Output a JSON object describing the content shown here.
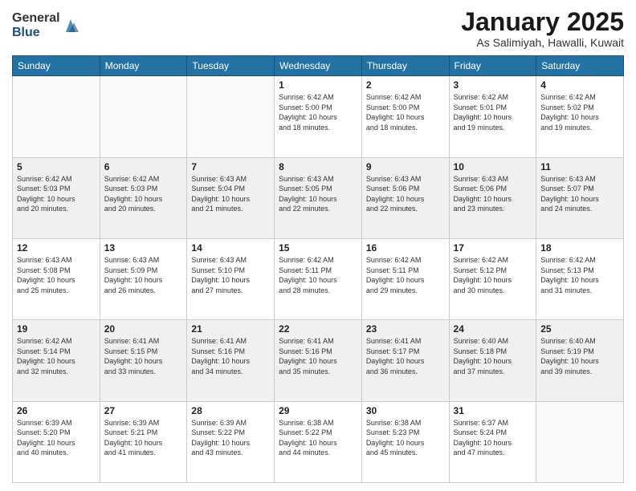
{
  "logo": {
    "general": "General",
    "blue": "Blue"
  },
  "title": "January 2025",
  "location": "As Salimiyah, Hawalli, Kuwait",
  "weekdays": [
    "Sunday",
    "Monday",
    "Tuesday",
    "Wednesday",
    "Thursday",
    "Friday",
    "Saturday"
  ],
  "weeks": [
    [
      {
        "day": "",
        "info": ""
      },
      {
        "day": "",
        "info": ""
      },
      {
        "day": "",
        "info": ""
      },
      {
        "day": "1",
        "info": "Sunrise: 6:42 AM\nSunset: 5:00 PM\nDaylight: 10 hours\nand 18 minutes."
      },
      {
        "day": "2",
        "info": "Sunrise: 6:42 AM\nSunset: 5:00 PM\nDaylight: 10 hours\nand 18 minutes."
      },
      {
        "day": "3",
        "info": "Sunrise: 6:42 AM\nSunset: 5:01 PM\nDaylight: 10 hours\nand 19 minutes."
      },
      {
        "day": "4",
        "info": "Sunrise: 6:42 AM\nSunset: 5:02 PM\nDaylight: 10 hours\nand 19 minutes."
      }
    ],
    [
      {
        "day": "5",
        "info": "Sunrise: 6:42 AM\nSunset: 5:03 PM\nDaylight: 10 hours\nand 20 minutes."
      },
      {
        "day": "6",
        "info": "Sunrise: 6:42 AM\nSunset: 5:03 PM\nDaylight: 10 hours\nand 20 minutes."
      },
      {
        "day": "7",
        "info": "Sunrise: 6:43 AM\nSunset: 5:04 PM\nDaylight: 10 hours\nand 21 minutes."
      },
      {
        "day": "8",
        "info": "Sunrise: 6:43 AM\nSunset: 5:05 PM\nDaylight: 10 hours\nand 22 minutes."
      },
      {
        "day": "9",
        "info": "Sunrise: 6:43 AM\nSunset: 5:06 PM\nDaylight: 10 hours\nand 22 minutes."
      },
      {
        "day": "10",
        "info": "Sunrise: 6:43 AM\nSunset: 5:06 PM\nDaylight: 10 hours\nand 23 minutes."
      },
      {
        "day": "11",
        "info": "Sunrise: 6:43 AM\nSunset: 5:07 PM\nDaylight: 10 hours\nand 24 minutes."
      }
    ],
    [
      {
        "day": "12",
        "info": "Sunrise: 6:43 AM\nSunset: 5:08 PM\nDaylight: 10 hours\nand 25 minutes."
      },
      {
        "day": "13",
        "info": "Sunrise: 6:43 AM\nSunset: 5:09 PM\nDaylight: 10 hours\nand 26 minutes."
      },
      {
        "day": "14",
        "info": "Sunrise: 6:43 AM\nSunset: 5:10 PM\nDaylight: 10 hours\nand 27 minutes."
      },
      {
        "day": "15",
        "info": "Sunrise: 6:42 AM\nSunset: 5:11 PM\nDaylight: 10 hours\nand 28 minutes."
      },
      {
        "day": "16",
        "info": "Sunrise: 6:42 AM\nSunset: 5:11 PM\nDaylight: 10 hours\nand 29 minutes."
      },
      {
        "day": "17",
        "info": "Sunrise: 6:42 AM\nSunset: 5:12 PM\nDaylight: 10 hours\nand 30 minutes."
      },
      {
        "day": "18",
        "info": "Sunrise: 6:42 AM\nSunset: 5:13 PM\nDaylight: 10 hours\nand 31 minutes."
      }
    ],
    [
      {
        "day": "19",
        "info": "Sunrise: 6:42 AM\nSunset: 5:14 PM\nDaylight: 10 hours\nand 32 minutes."
      },
      {
        "day": "20",
        "info": "Sunrise: 6:41 AM\nSunset: 5:15 PM\nDaylight: 10 hours\nand 33 minutes."
      },
      {
        "day": "21",
        "info": "Sunrise: 6:41 AM\nSunset: 5:16 PM\nDaylight: 10 hours\nand 34 minutes."
      },
      {
        "day": "22",
        "info": "Sunrise: 6:41 AM\nSunset: 5:16 PM\nDaylight: 10 hours\nand 35 minutes."
      },
      {
        "day": "23",
        "info": "Sunrise: 6:41 AM\nSunset: 5:17 PM\nDaylight: 10 hours\nand 36 minutes."
      },
      {
        "day": "24",
        "info": "Sunrise: 6:40 AM\nSunset: 5:18 PM\nDaylight: 10 hours\nand 37 minutes."
      },
      {
        "day": "25",
        "info": "Sunrise: 6:40 AM\nSunset: 5:19 PM\nDaylight: 10 hours\nand 39 minutes."
      }
    ],
    [
      {
        "day": "26",
        "info": "Sunrise: 6:39 AM\nSunset: 5:20 PM\nDaylight: 10 hours\nand 40 minutes."
      },
      {
        "day": "27",
        "info": "Sunrise: 6:39 AM\nSunset: 5:21 PM\nDaylight: 10 hours\nand 41 minutes."
      },
      {
        "day": "28",
        "info": "Sunrise: 6:39 AM\nSunset: 5:22 PM\nDaylight: 10 hours\nand 43 minutes."
      },
      {
        "day": "29",
        "info": "Sunrise: 6:38 AM\nSunset: 5:22 PM\nDaylight: 10 hours\nand 44 minutes."
      },
      {
        "day": "30",
        "info": "Sunrise: 6:38 AM\nSunset: 5:23 PM\nDaylight: 10 hours\nand 45 minutes."
      },
      {
        "day": "31",
        "info": "Sunrise: 6:37 AM\nSunset: 5:24 PM\nDaylight: 10 hours\nand 47 minutes."
      },
      {
        "day": "",
        "info": ""
      }
    ]
  ]
}
